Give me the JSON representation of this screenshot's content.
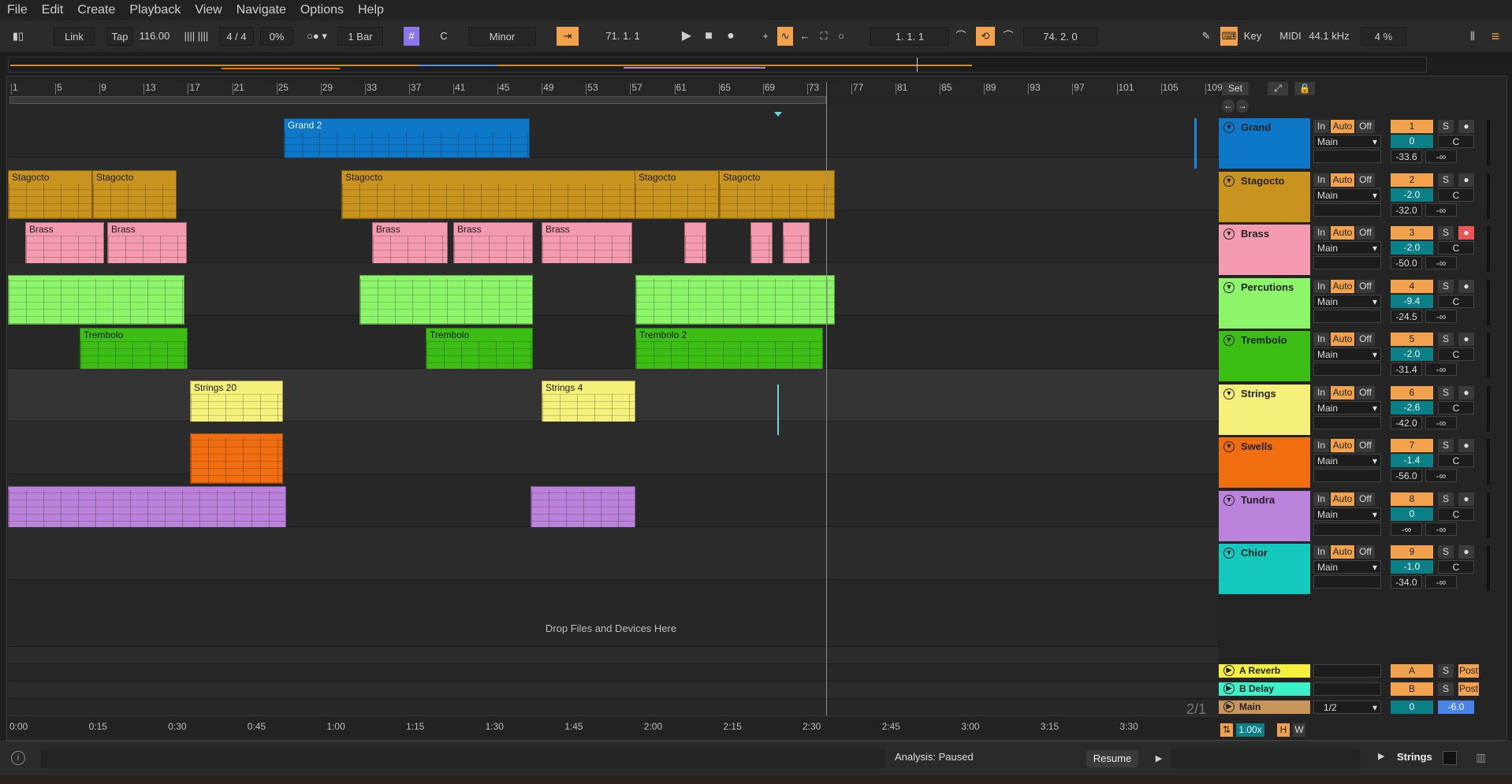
{
  "menu": [
    "File",
    "Edit",
    "Create",
    "Playback",
    "View",
    "Navigate",
    "Options",
    "Help"
  ],
  "control": {
    "link": "Link",
    "tap": "Tap",
    "tempo": "116.00",
    "signature": "4 / 4",
    "groove": "0%",
    "quantize": "1 Bar",
    "key_root": "C",
    "scale": "Minor",
    "position": "71.   1.   1",
    "loop_start": "1.   1.   1",
    "loop_length": "74.   2.   0",
    "key_label": "Key",
    "midi_label": "MIDI",
    "sample_rate": "44.1 kHz",
    "cpu": "4 %"
  },
  "ruler_bars": [
    "1",
    "5",
    "9",
    "13",
    "17",
    "21",
    "25",
    "29",
    "33",
    "37",
    "41",
    "45",
    "49",
    "53",
    "57",
    "61",
    "65",
    "69",
    "73",
    "77",
    "81",
    "85",
    "89",
    "93",
    "97",
    "101",
    "105",
    "109"
  ],
  "time_labels": [
    "0:00",
    "0:15",
    "0:30",
    "0:45",
    "1:00",
    "1:15",
    "1:30",
    "1:45",
    "2:00",
    "2:15",
    "2:30",
    "2:45",
    "3:00",
    "3:15",
    "3:30"
  ],
  "set_label": "Set",
  "drop_hint": "Drop Files and Devices Here",
  "page_count": "2/1",
  "tracks": [
    {
      "name": "Grand",
      "color": "#0e78c8",
      "num": "1",
      "vol": "0",
      "pan": "C",
      "peak": "-33.6",
      "peak2": "-∞",
      "input": "Main"
    },
    {
      "name": "Stagocto",
      "color": "#c8941e",
      "num": "2",
      "vol": "-2.0",
      "pan": "C",
      "peak": "-32.0",
      "peak2": "-∞",
      "input": "Main"
    },
    {
      "name": "Brass",
      "color": "#f59bb0",
      "num": "3",
      "vol": "-2.0",
      "pan": "C",
      "peak": "-50.0",
      "peak2": "-∞",
      "input": "Main"
    },
    {
      "name": "Percutions",
      "color": "#8cf56a",
      "num": "4",
      "vol": "-9.4",
      "pan": "C",
      "peak": "-24.5",
      "peak2": "-∞",
      "input": "Main"
    },
    {
      "name": "Trembolo",
      "color": "#3cbe14",
      "num": "5",
      "vol": "-2.0",
      "pan": "C",
      "peak": "-31.4",
      "peak2": "-∞",
      "input": "Main"
    },
    {
      "name": "Strings",
      "color": "#f5f07a",
      "num": "6",
      "vol": "-2.6",
      "pan": "C",
      "peak": "-42.0",
      "peak2": "-∞",
      "input": "Main"
    },
    {
      "name": "Swells",
      "color": "#f06e10",
      "num": "7",
      "vol": "-1.4",
      "pan": "C",
      "peak": "-56.0",
      "peak2": "-∞",
      "input": "Main"
    },
    {
      "name": "Tundra",
      "color": "#bb82dc",
      "num": "8",
      "vol": "0",
      "pan": "C",
      "peak": "-∞",
      "peak2": "-∞",
      "input": "Main"
    },
    {
      "name": "Chior",
      "color": "#14c8be",
      "num": "9",
      "vol": "-1.0",
      "pan": "C",
      "peak": "-34.0",
      "peak2": "-∞",
      "input": "Main"
    }
  ],
  "buttons": {
    "in": "In",
    "auto": "Auto",
    "off": "Off",
    "solo": "S"
  },
  "returns": [
    {
      "name": "A Reverb",
      "color": "#f5f03c",
      "letter": "A",
      "mode": "Post"
    },
    {
      "name": "B Delay",
      "color": "#3cf0c8",
      "letter": "B",
      "mode": "Post"
    },
    {
      "name": "Main",
      "color": "#c8965a",
      "letter": "0",
      "mode": "-6.0",
      "routing": "1/2"
    }
  ],
  "clips": {
    "grand": [
      "Grand 2"
    ],
    "stagocto": [
      "Stagocto",
      "Stagocto",
      "Stagocto",
      "Stagocto",
      "Stagocto"
    ],
    "brass": [
      "Brass",
      "Brass",
      "Brass",
      "Brass",
      "Brass"
    ],
    "trembolo": [
      "Trembolo",
      "Trembolo",
      "Trembolo 2"
    ],
    "strings": [
      "Strings 20",
      "Strings 4"
    ]
  },
  "zoom": "1.00x",
  "h_label": "H",
  "w_label": "W",
  "status": {
    "analysis": "Analysis: Paused",
    "resume": "Resume",
    "selected_track": "Strings"
  }
}
